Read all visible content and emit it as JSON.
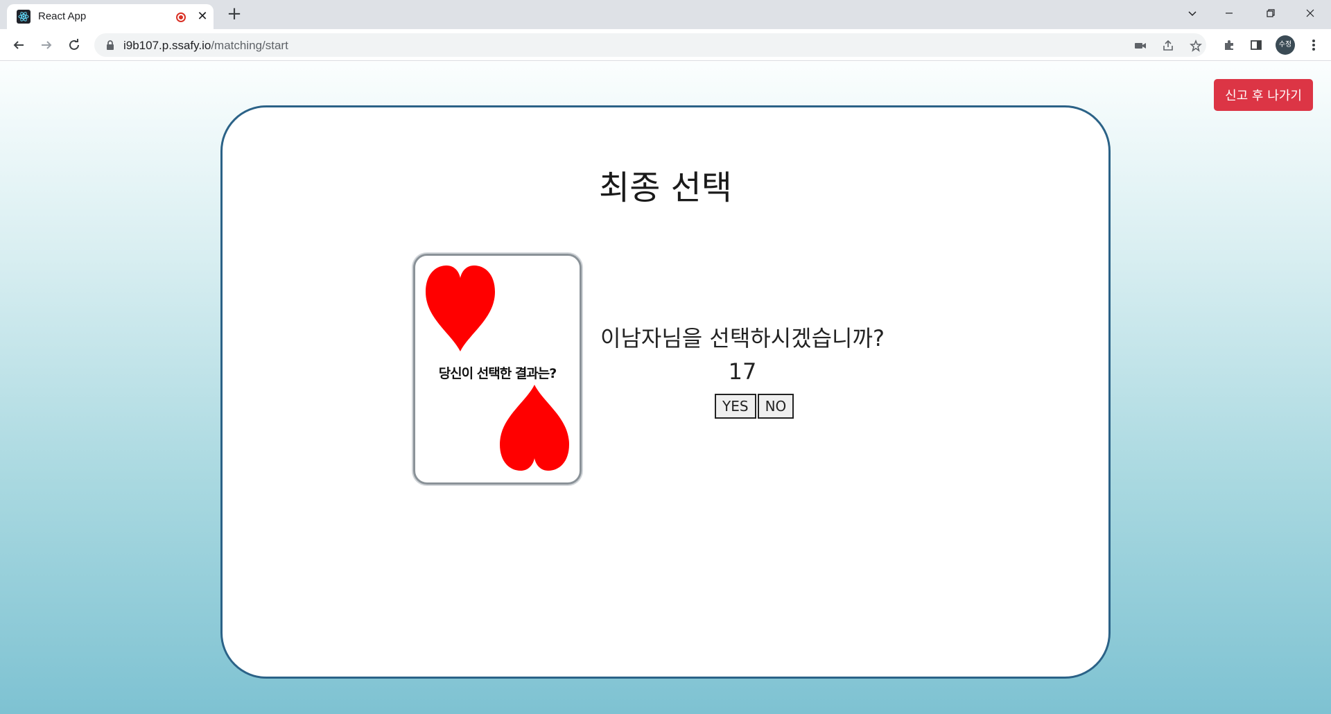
{
  "browser": {
    "tab_title": "React App",
    "url_host": "i9b107.p.ssafy.io",
    "url_path": "/matching/start",
    "profile_label": "수정"
  },
  "page": {
    "report_exit_label": "신고 후 나가기",
    "title": "최종 선택",
    "card_text": "당신이 선택한 결과는?",
    "question": "이남자님을 선택하시겠습니까?",
    "countdown": "17",
    "yes_label": "YES",
    "no_label": "NO"
  },
  "colors": {
    "panel_border": "#2b6287",
    "report_button": "#dc3545",
    "heart": "#ff0000"
  }
}
